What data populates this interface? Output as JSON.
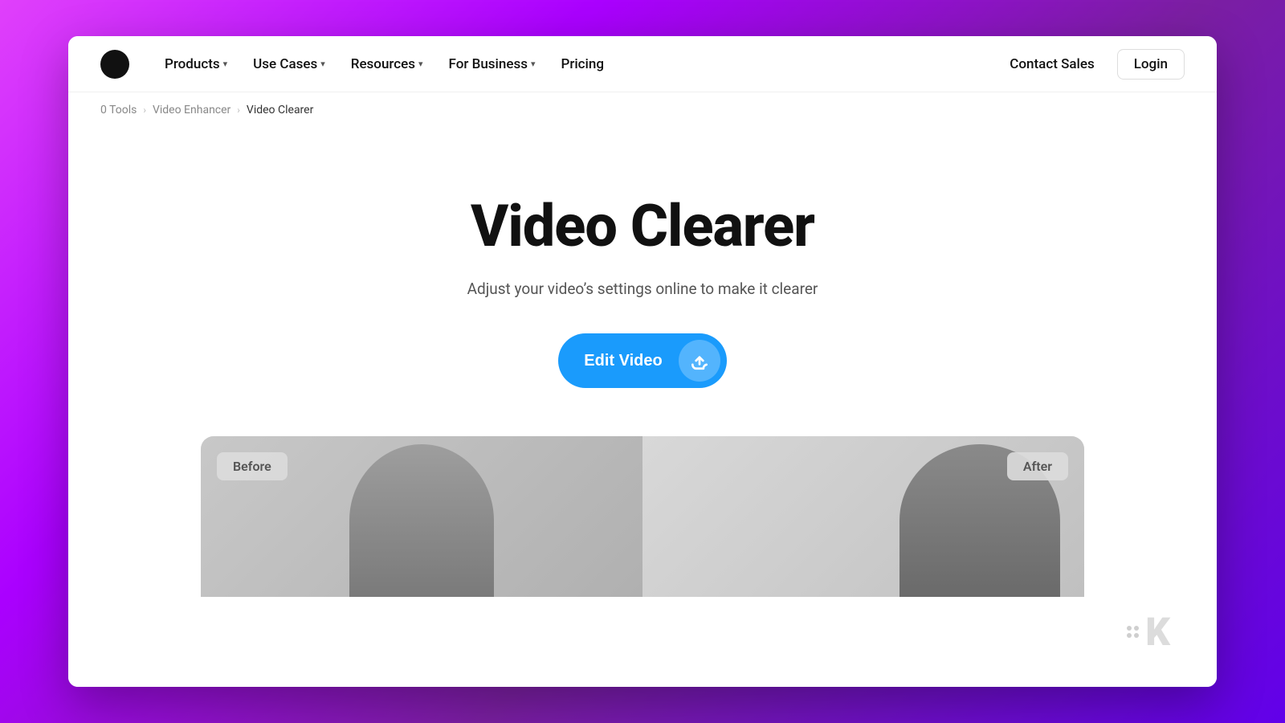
{
  "background": {
    "gradient_start": "#e040fb",
    "gradient_end": "#6200ea"
  },
  "navbar": {
    "logo_alt": "Logo",
    "nav_items": [
      {
        "label": "Products",
        "has_dropdown": true
      },
      {
        "label": "Use Cases",
        "has_dropdown": true
      },
      {
        "label": "Resources",
        "has_dropdown": true
      },
      {
        "label": "For Business",
        "has_dropdown": true
      },
      {
        "label": "Pricing",
        "has_dropdown": false
      }
    ],
    "contact_sales_label": "Contact Sales",
    "login_label": "Login"
  },
  "breadcrumb": {
    "items": [
      {
        "label": "0 Tools",
        "active": false
      },
      {
        "label": "Video Enhancer",
        "active": false
      },
      {
        "label": "Video Clearer",
        "active": true
      }
    ]
  },
  "hero": {
    "title": "Video Clearer",
    "subtitle": "Adjust your video’s settings online to make it clearer",
    "cta_label": "Edit Video",
    "upload_icon": "upload-icon"
  },
  "preview": {
    "before_label": "Before",
    "after_label": "After"
  },
  "watermark": {
    "brand": "K"
  }
}
